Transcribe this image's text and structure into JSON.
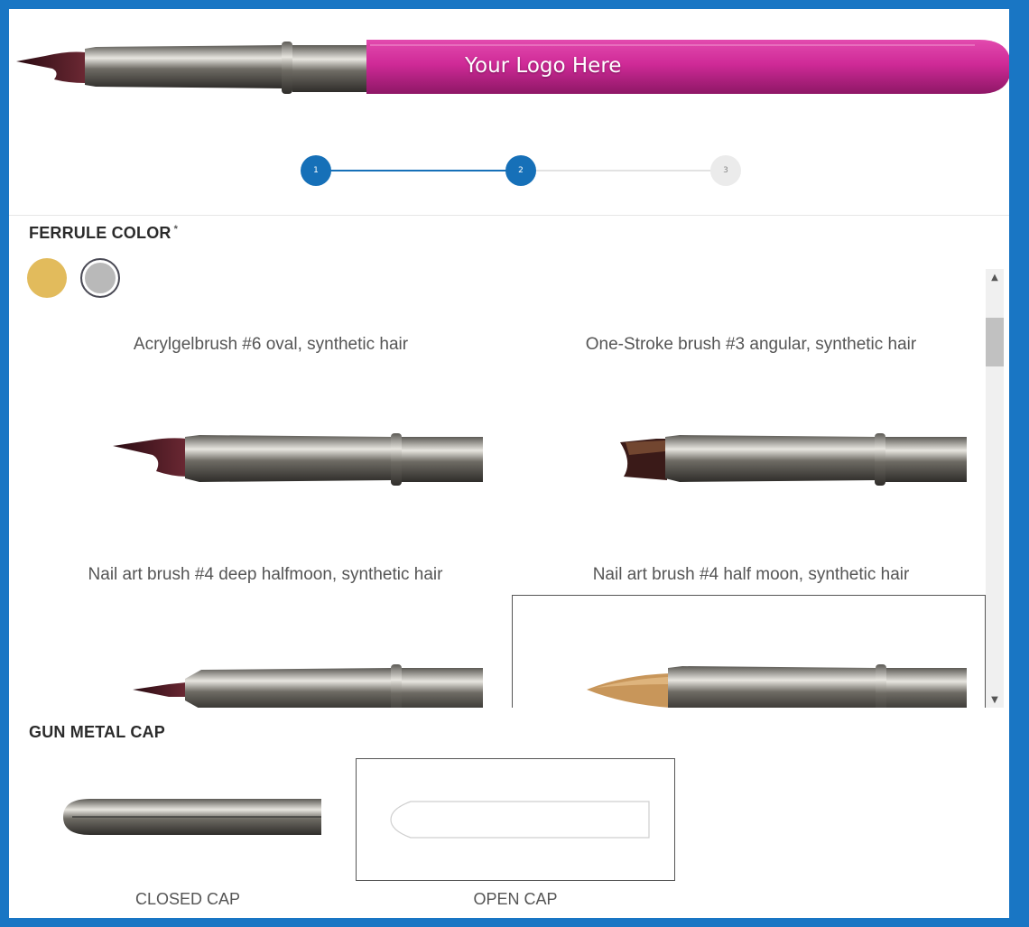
{
  "hero": {
    "logo_text": "Your Logo Here",
    "handle_color": "#d02a9a"
  },
  "stepper": {
    "steps": [
      {
        "label": "1",
        "state": "active"
      },
      {
        "label": "2",
        "state": "active"
      },
      {
        "label": "3",
        "state": "inactive"
      }
    ],
    "accent": "#1670b8"
  },
  "ferrule": {
    "title": "FERRULE COLOR",
    "required_mark": "*",
    "swatches": [
      {
        "name": "gold",
        "color": "#e2bb5c",
        "selected": false
      },
      {
        "name": "silver",
        "color": "#b9b9b9",
        "selected": true
      }
    ]
  },
  "brushes": [
    {
      "label": "Acrylgelbrush #6 oval, synthetic hair",
      "tip": "dark-curved",
      "selected": false
    },
    {
      "label": "One-Stroke brush #3 angular, synthetic hair",
      "tip": "dark-angular",
      "selected": false
    },
    {
      "label": "Nail art brush #4 deep halfmoon, synthetic hair",
      "tip": "dark-pointed",
      "selected": false
    },
    {
      "label": "Nail art brush #4 half moon, synthetic hair",
      "tip": "tan-oval",
      "selected": true
    }
  ],
  "cap": {
    "title": "GUN METAL CAP",
    "options": [
      {
        "label": "CLOSED CAP",
        "selected": false
      },
      {
        "label": "OPEN CAP",
        "selected": true
      }
    ]
  }
}
